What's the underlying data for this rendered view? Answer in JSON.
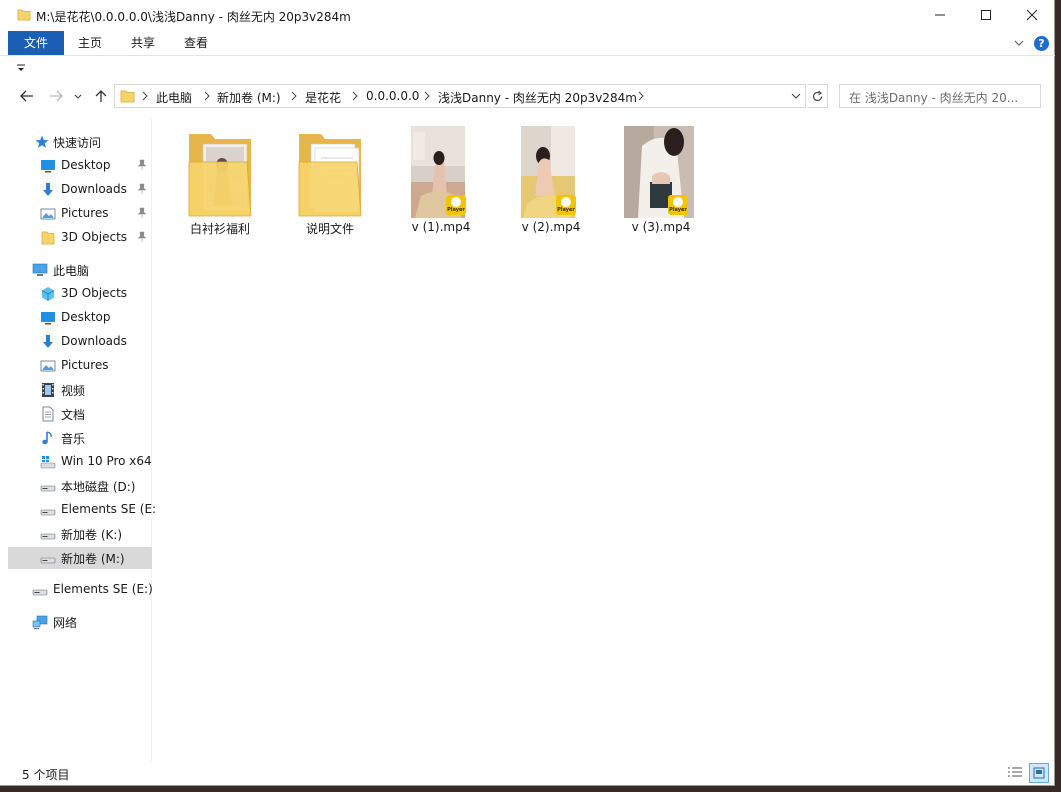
{
  "window": {
    "title": "M:\\是花花\\0.0.0.0.0\\浅浅Danny - 肉丝无内 20p3v284m"
  },
  "ribbon": {
    "tabs": [
      {
        "label": "文件",
        "active": true
      },
      {
        "label": "主页",
        "active": false
      },
      {
        "label": "共享",
        "active": false
      },
      {
        "label": "查看",
        "active": false
      }
    ],
    "help_label": "?"
  },
  "address_bar": {
    "segments": [
      "此电脑",
      "新加卷 (M:)",
      "是花花",
      "0.0.0.0.0",
      "浅浅Danny - 肉丝无内 20p3v284m"
    ]
  },
  "search": {
    "placeholder": "在 浅浅Danny - 肉丝无内 20..."
  },
  "nav_pane": {
    "quick_access_label": "快速访问",
    "quick_access_items": [
      {
        "label": "Desktop",
        "icon": "desktop-icon",
        "pinned": true
      },
      {
        "label": "Downloads",
        "icon": "downloads-icon",
        "pinned": true
      },
      {
        "label": "Pictures",
        "icon": "pictures-icon",
        "pinned": true
      },
      {
        "label": "3D Objects",
        "icon": "folder-icon",
        "pinned": true
      }
    ],
    "this_pc_label": "此电脑",
    "this_pc_items": [
      {
        "label": "3D Objects",
        "icon": "3d-objects-icon"
      },
      {
        "label": "Desktop",
        "icon": "desktop-icon"
      },
      {
        "label": "Downloads",
        "icon": "downloads-icon"
      },
      {
        "label": "Pictures",
        "icon": "pictures-icon"
      },
      {
        "label": "视频",
        "icon": "videos-icon"
      },
      {
        "label": "文档",
        "icon": "documents-icon"
      },
      {
        "label": "音乐",
        "icon": "music-icon"
      },
      {
        "label": "Win 10 Pro x64",
        "icon": "system-drive-icon"
      },
      {
        "label": "本地磁盘 (D:)",
        "icon": "drive-icon"
      },
      {
        "label": "Elements SE (E:",
        "icon": "drive-icon"
      },
      {
        "label": "新加卷 (K:)",
        "icon": "drive-icon"
      },
      {
        "label": "新加卷 (M:)",
        "icon": "drive-icon",
        "selected": true
      }
    ],
    "external_drive_label": "Elements SE (E:)",
    "network_label": "网络"
  },
  "files": [
    {
      "name": "白衬衫福利",
      "type": "folder-with-photos"
    },
    {
      "name": "说明文件",
      "type": "folder-with-docs"
    },
    {
      "name": "v (1).mp4",
      "type": "video"
    },
    {
      "name": "v (2).mp4",
      "type": "video"
    },
    {
      "name": "v (3).mp4",
      "type": "video"
    }
  ],
  "player_badge_text": "Player",
  "status": {
    "item_count": "5 个项目"
  },
  "colors": {
    "accent": "#1a5fb4",
    "folder": "#f7d46a",
    "badge": "#f5c400",
    "selected_row": "#d9d9d9"
  }
}
